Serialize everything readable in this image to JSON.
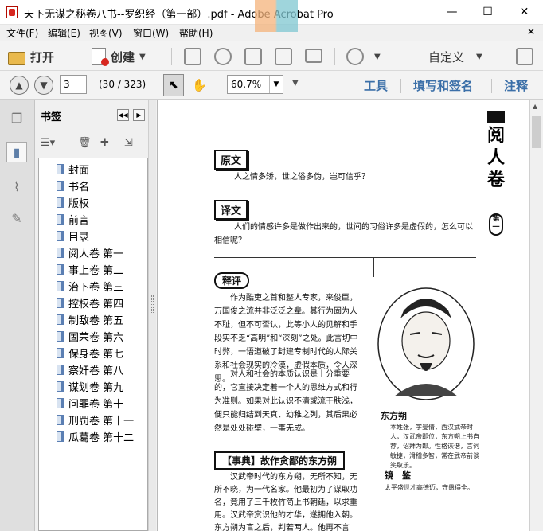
{
  "window": {
    "title": "天下无谋之秘卷八书--罗织经（第一部）.pdf - Adobe Acrobat Pro",
    "minimize_glyph": "—",
    "maximize_glyph": "☐",
    "close_glyph": "✕"
  },
  "menu": {
    "items": [
      "文件(F)",
      "编辑(E)",
      "视图(V)",
      "窗口(W)",
      "帮助(H)"
    ],
    "close_glyph": "✕"
  },
  "toolbar": {
    "open_label": "打开",
    "create_label": "创建",
    "customize_label": "自定义"
  },
  "nav": {
    "page_value": "3",
    "page_count": "(30 / 323)",
    "zoom_value": "60.7%",
    "tabs": [
      "工具",
      "填写和签名",
      "注释"
    ]
  },
  "bookmarks": {
    "title": "书签",
    "items": [
      "封面",
      "书名",
      "版权",
      "前言",
      "目录",
      "阅人卷 第一",
      "事上卷 第二",
      "治下卷 第三",
      "控权卷 第四",
      "制敌卷 第五",
      "固荣卷 第六",
      "保身卷 第七",
      "察奸卷 第八",
      "谋划卷 第九",
      "问罪卷 第十",
      "刑罚卷 第十一",
      "瓜葛卷 第十二"
    ]
  },
  "document": {
    "side_title": [
      "阅",
      "人",
      "卷"
    ],
    "side_chapter": "第一",
    "original_label": "原文",
    "original_text": "人之情多矫，世之俗多伪，岂可信乎？",
    "translation_label": "译文",
    "translation_text": "人们的情感许多是做作出来的，世间的习俗许多是虚假的，怎么可以相信呢？",
    "commentary_label": "释评",
    "commentary_text": "作为酷吏之首和整人专家，来俊臣，万国俊之流并非泛泛之辈。其行为固为人不耻，但不可否认，此等小人的见解和手段实不乏“高明”和“深刻”之处。此言切中时弊，一语道破了封建专制时代的人际关系和社会现实的冷漠，虚假本质，令人深思。",
    "commentary_text2": "对人和社会的本质认识是十分重要的，它直接决定着一个人的思维方式和行为准则。如果对此认识不清或流于肤浅，便只能归结到天真、幼稚之列，其后果必然是处处碰壁，一事无成。",
    "portrait_caption": "东方朔",
    "portrait_text": "本姓张，字曼倩，西汉武帝时人，汉武帝即位，东方朔上书自荐，诏拜为郎。性格诙谐，言词敏捷，滑稽多智，常在武帝前谈笑取乐。",
    "mirror_label": "镜　鉴",
    "mirror_text": "太平盛世才高德迈，守愚得全。",
    "story_title": "【事典】故作贪鄙的东方朔",
    "story_text": "汉武帝时代的东方朔，无所不知，无所不晓，为一代名家。他最初为了谋取功名，竟用了三千枚竹简上书朝廷，以求重用。汉武帝赏识他的才华，遂拥他入朝。东方朔为官之后，判若两人。他再不言"
  }
}
